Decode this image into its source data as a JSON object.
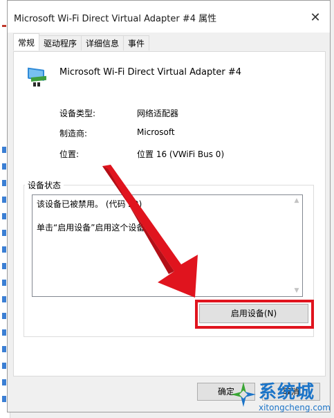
{
  "window": {
    "title": "Microsoft Wi-Fi Direct Virtual Adapter #4 属性",
    "close_glyph": "✕"
  },
  "tabs": [
    {
      "label": "常规",
      "active": true
    },
    {
      "label": "驱动程序",
      "active": false
    },
    {
      "label": "详细信息",
      "active": false
    },
    {
      "label": "事件",
      "active": false
    }
  ],
  "device": {
    "name": "Microsoft Wi-Fi Direct Virtual Adapter #4",
    "icon": "network-adapter-icon"
  },
  "properties": [
    {
      "label": "设备类型:",
      "value": "网络适配器"
    },
    {
      "label": "制造商:",
      "value": "Microsoft"
    },
    {
      "label": "位置:",
      "value": "位置 16 (VWiFi Bus 0)"
    }
  ],
  "status": {
    "group_title": "设备状态",
    "line1": "该设备已被禁用。 (代码 22)",
    "line2": "单击“启用设备”启用这个设备。"
  },
  "buttons": {
    "enable": "启用设备(N)",
    "ok": "确定",
    "cancel": "取消"
  },
  "annotation": {
    "arrow_color": "#e0141e",
    "highlight_color": "#e0141e"
  },
  "watermark": {
    "brand": "系统城",
    "url": "xitongcheng.com"
  }
}
